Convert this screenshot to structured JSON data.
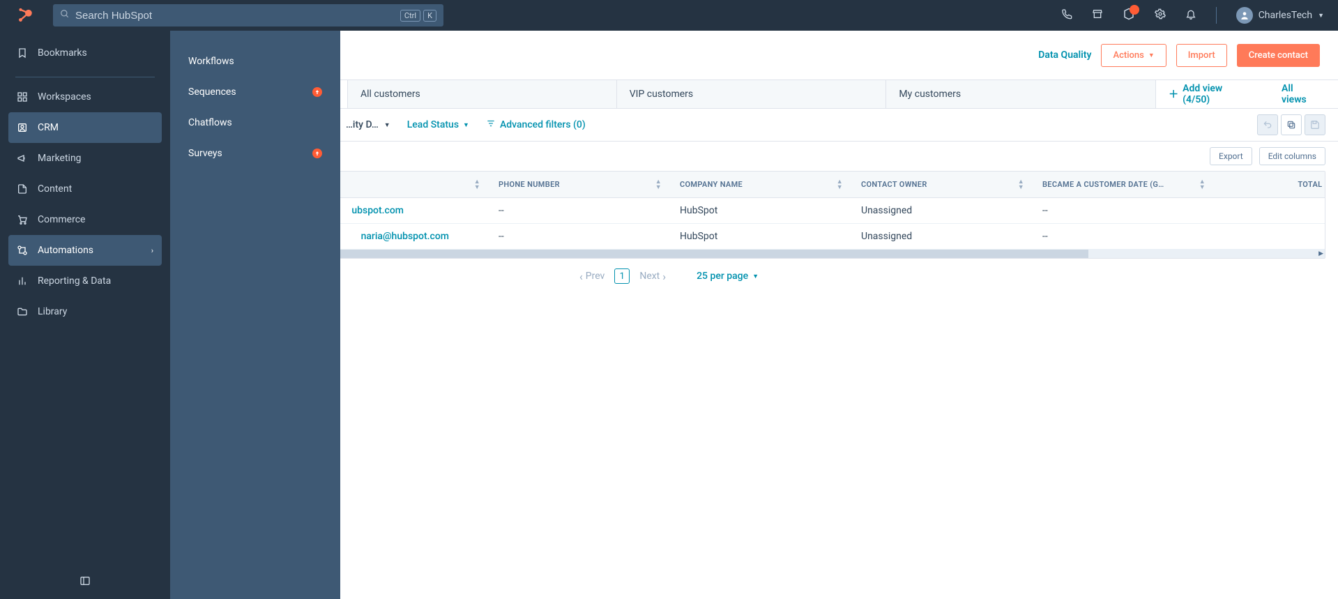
{
  "header": {
    "search_placeholder": "Search HubSpot",
    "kbd1": "Ctrl",
    "kbd2": "K",
    "user_name": "CharlesTech",
    "notif_count": ""
  },
  "sidebar": {
    "items": [
      {
        "label": "Bookmarks",
        "divider_after": true
      },
      {
        "label": "Workspaces"
      },
      {
        "label": "CRM",
        "active": true
      },
      {
        "label": "Marketing"
      },
      {
        "label": "Content"
      },
      {
        "label": "Commerce"
      },
      {
        "label": "Automations",
        "active": true,
        "has_chevron": true
      },
      {
        "label": "Reporting & Data"
      },
      {
        "label": "Library"
      }
    ]
  },
  "flyout": {
    "items": [
      {
        "label": "Workflows"
      },
      {
        "label": "Sequences",
        "upgrade": true
      },
      {
        "label": "Chatflows"
      },
      {
        "label": "Surveys",
        "upgrade": true
      }
    ]
  },
  "page": {
    "data_quality": "Data Quality",
    "actions": "Actions",
    "import": "Import",
    "create": "Create contact"
  },
  "tabs": {
    "items": [
      "All customers",
      "VIP customers",
      "My customers"
    ],
    "add_view": "Add view (4/50)",
    "all_views": "All views"
  },
  "filters": {
    "truncated": "…ity D…",
    "lead_status": "Lead Status",
    "advanced": "Advanced filters (0)"
  },
  "table": {
    "export": "Export",
    "edit_columns": "Edit columns",
    "columns": [
      "",
      "PHONE NUMBER",
      "COMPANY NAME",
      "CONTACT OWNER",
      "BECAME A CUSTOMER DATE (G…",
      "TOTAL REVENU"
    ],
    "rows": [
      {
        "email": "ubspot.com",
        "phone": "--",
        "company": "HubSpot",
        "owner": "Unassigned",
        "date": "--",
        "revenue": ""
      },
      {
        "email": "naria@hubspot.com",
        "phone": "--",
        "company": "HubSpot",
        "owner": "Unassigned",
        "date": "--",
        "revenue": ""
      }
    ]
  },
  "pager": {
    "prev": "Prev",
    "page": "1",
    "next": "Next",
    "per_page": "25 per page"
  }
}
